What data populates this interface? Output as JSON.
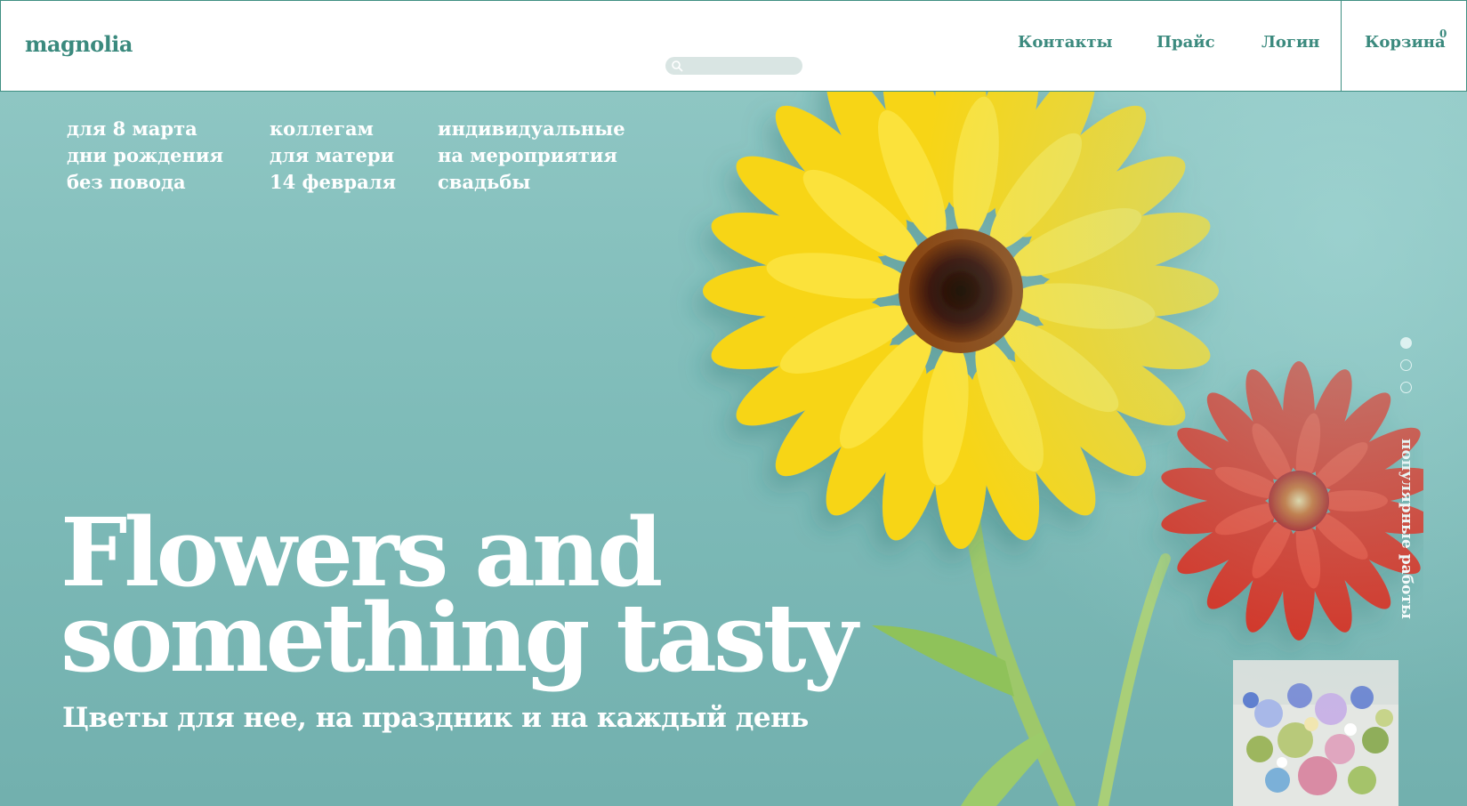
{
  "brand": {
    "logo": "magnolia"
  },
  "header": {
    "nav": {
      "contacts": "Контакты",
      "price": "Прайс",
      "login": "Логин",
      "cart": "Корзина",
      "cart_count": "0"
    }
  },
  "hero": {
    "categories": [
      [
        "для 8 марта",
        "дни рождения",
        "без повода"
      ],
      [
        "коллегам",
        "для матери",
        "14 февраля"
      ],
      [
        "индивидуальные",
        "на мероприятия",
        "свадьбы"
      ]
    ],
    "headline_line1": "Flowers and",
    "headline_line2": "something tasty",
    "subheadline": "Цветы для нее, на праздник и на каждый день",
    "side_label": "популярные работы",
    "slides": {
      "count": 3,
      "active": 1
    }
  },
  "colors": {
    "accent": "#3b8a7e",
    "hero_bg": "#82bfbc",
    "yellow_flower": "#f6d30d",
    "red_flower": "#d9261c"
  },
  "icons": [
    "search-icon"
  ]
}
